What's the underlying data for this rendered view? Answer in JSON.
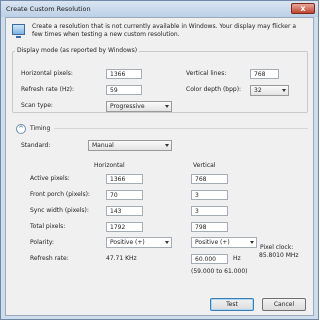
{
  "window": {
    "title": "Create Custom Resolution",
    "close_label": "x"
  },
  "intro": "Create a resolution that is not currently available in Windows. Your display may flicker a few times when testing a new custom resolution.",
  "display_mode": {
    "group_label": "Display mode (as reported by Windows)",
    "horizontal_pixels": {
      "label": "Horizontal pixels:",
      "value": "1366"
    },
    "vertical_lines": {
      "label": "Vertical lines:",
      "value": "768"
    },
    "refresh_rate": {
      "label": "Refresh rate (Hz):",
      "value": "59"
    },
    "color_depth": {
      "label": "Color depth (bpp):",
      "value": "32"
    },
    "scan_type": {
      "label": "Scan type:",
      "value": "Progressive"
    }
  },
  "timing": {
    "toggle_symbol": "^",
    "group_label": "Timing",
    "standard": {
      "label": "Standard:",
      "value": "Manual"
    },
    "col_horizontal": "Horizontal",
    "col_vertical": "Vertical",
    "rows": [
      {
        "label": "Active pixels:",
        "h": "1366",
        "v": "768"
      },
      {
        "label": "Front porch (pixels):",
        "h": "70",
        "v": "3"
      },
      {
        "label": "Sync width (pixels):",
        "h": "143",
        "v": "3"
      },
      {
        "label": "Total pixels:",
        "h": "1792",
        "v": "798"
      }
    ],
    "polarity": {
      "label": "Polarity:",
      "h": "Positive (+)",
      "v": "Positive (+)"
    },
    "pixel_clock": {
      "label": "Pixel clock:",
      "value": "85.8010 MHz"
    },
    "refresh": {
      "label": "Refresh rate:",
      "h": "47.71 KHz",
      "v": "60.000",
      "unit": "Hz",
      "range": "(59.000 to 61.000)"
    }
  },
  "buttons": {
    "test": "Test",
    "cancel": "Cancel"
  }
}
